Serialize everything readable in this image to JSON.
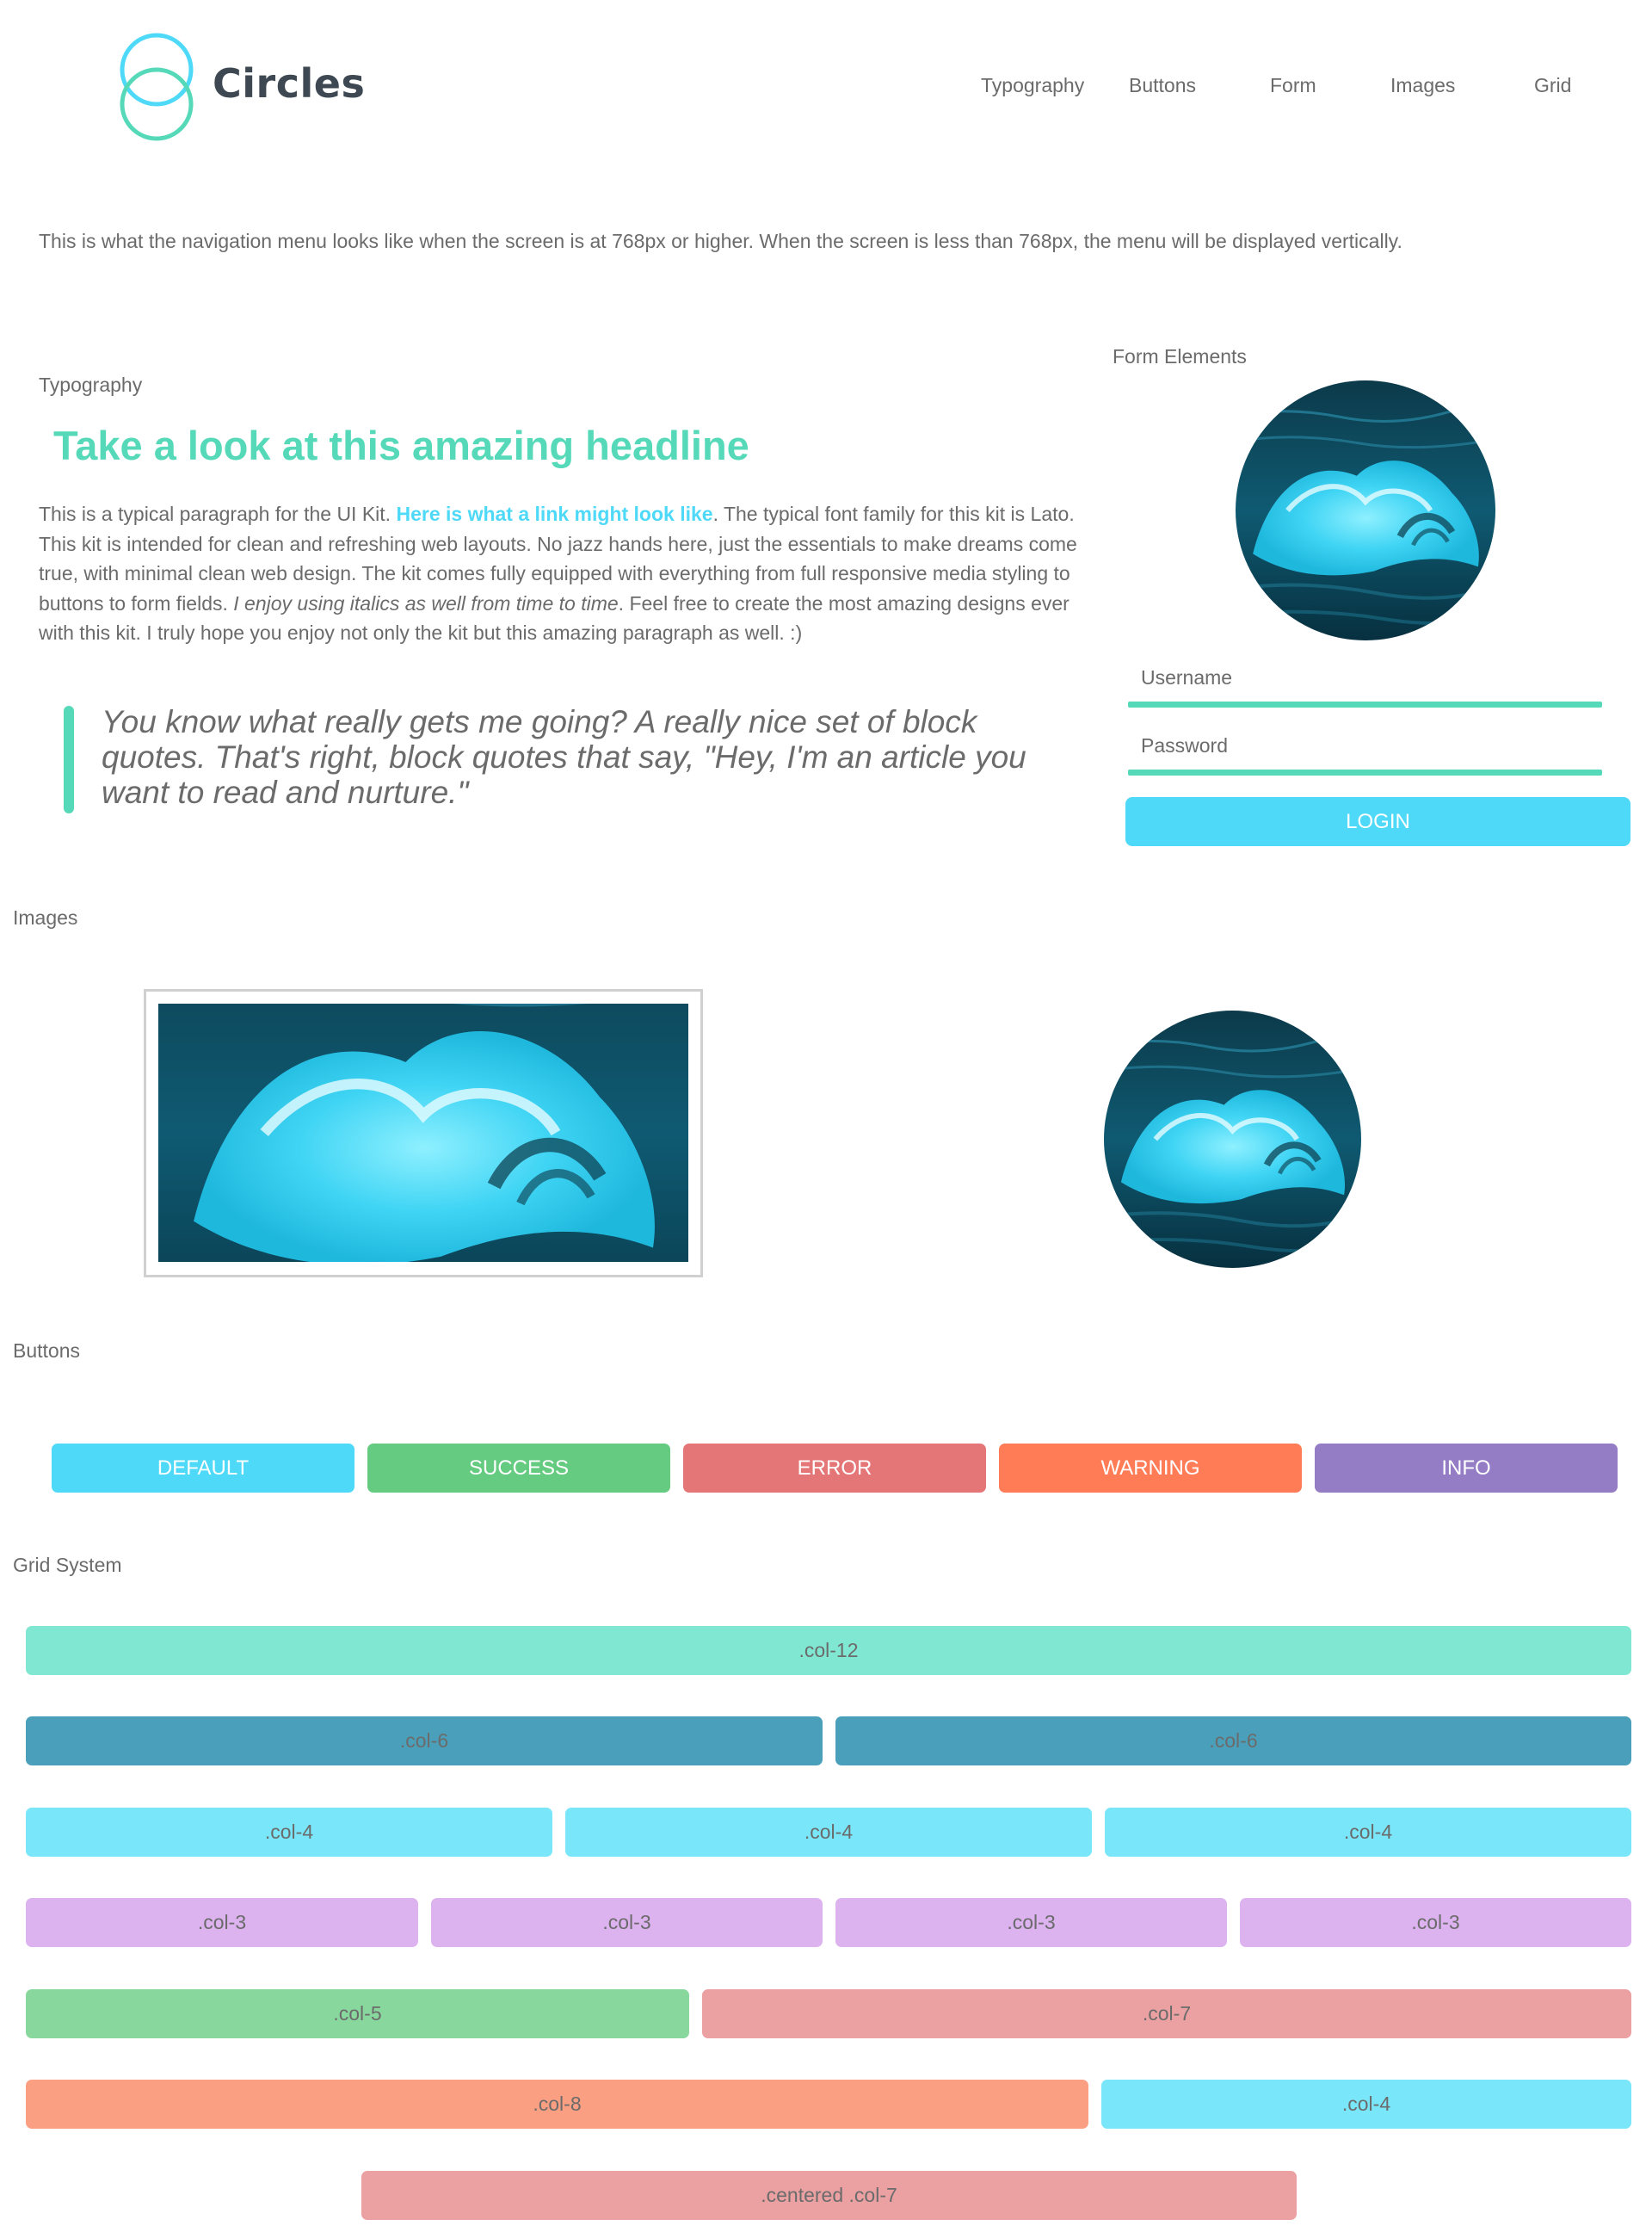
{
  "header": {
    "logo_text": "Circles",
    "logo_color": "#4dd9f7",
    "nav": [
      "Typography",
      "Buttons",
      "Form",
      "Images",
      "Grid"
    ]
  },
  "intro": "This is what the navigation menu looks like when the screen is at 768px or higher. When the screen is less than 768px, the menu will be displayed vertically.",
  "typography": {
    "label": "Typography",
    "headline": "Take a look at this amazing headline",
    "headline_color": "#55d9b8",
    "para_start": "This is a typical paragraph for the UI Kit. ",
    "link_text": "Here is what a link might look like",
    "para_mid": ". The typical font family for this kit is Lato. This kit is intended for clean and refreshing web layouts. No jazz hands here, just the essentials to make dreams come true, with minimal clean web design. The kit comes fully equipped with everything from full responsive media styling to buttons to form fields. ",
    "para_italic": "I enjoy using italics as well from time to time",
    "para_end": ". Feel free to create the most amazing designs ever with this kit. I truly hope you enjoy not only the kit but this amazing paragraph as well. :)",
    "blockquote": "You know what really gets me going? A really nice set of block quotes. That's right, block quotes that say, \"Hey, I'm an article you want to read and nurture.\""
  },
  "form": {
    "label": "Form Elements",
    "username_placeholder": "Username",
    "password_placeholder": "Password",
    "login_label": "LOGIN",
    "accent": "#55d9b8"
  },
  "images": {
    "label": "Images"
  },
  "buttons": {
    "label": "Buttons",
    "items": [
      {
        "label": "DEFAULT",
        "color": "#4dd9f7"
      },
      {
        "label": "SUCCESS",
        "color": "#65cb80"
      },
      {
        "label": "ERROR",
        "color": "#e57677"
      },
      {
        "label": "WARNING",
        "color": "#ff7c57"
      },
      {
        "label": "INFO",
        "color": "#947dc5"
      }
    ]
  },
  "grid": {
    "label": "Grid System",
    "rows": [
      [
        {
          "label": ".col-12",
          "color": "#80e8d2"
        }
      ],
      [
        {
          "label": ".col-6",
          "color": "#4aa0ba"
        },
        {
          "label": ".col-6",
          "color": "#4aa0ba"
        }
      ],
      [
        {
          "label": ".col-4",
          "color": "#7ae6f9"
        },
        {
          "label": ".col-4",
          "color": "#7ae6f9"
        },
        {
          "label": ".col-4",
          "color": "#7ae6f9"
        }
      ],
      [
        {
          "label": ".col-3",
          "color": "#dcb2ef"
        },
        {
          "label": ".col-3",
          "color": "#dcb2ef"
        },
        {
          "label": ".col-3",
          "color": "#dcb2ef"
        },
        {
          "label": ".col-3",
          "color": "#dcb2ef"
        }
      ],
      [
        {
          "label": ".col-5",
          "color": "#88d89e"
        },
        {
          "label": ".col-7",
          "color": "#eba0a2"
        }
      ],
      [
        {
          "label": ".col-8",
          "color": "#fb9f83"
        },
        {
          "label": ".col-4",
          "color": "#7ae6f9"
        }
      ],
      [
        {
          "label": ".centered .col-7",
          "color": "#eba0a2"
        }
      ]
    ]
  }
}
